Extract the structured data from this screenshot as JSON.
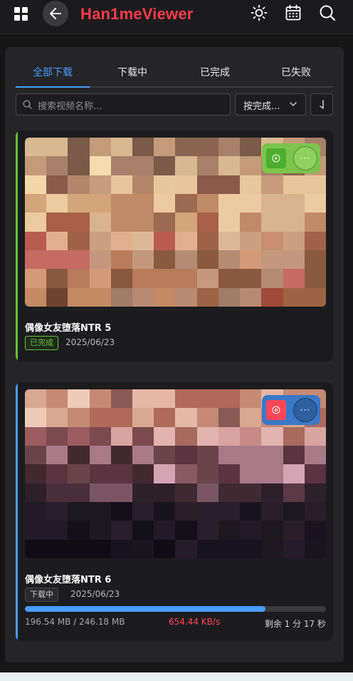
{
  "header": {
    "title": "Han1meViewer",
    "icons": [
      "grid-icon",
      "back-arrow-icon",
      "theme-sun-icon",
      "calendar-icon",
      "search-icon"
    ]
  },
  "tabs": [
    {
      "label": "全部下载",
      "active": true
    },
    {
      "label": "下载中",
      "active": false
    },
    {
      "label": "已完成",
      "active": false
    },
    {
      "label": "已失败",
      "active": false
    }
  ],
  "filters": {
    "search_placeholder": "搜索视频名称...",
    "sort_value": "按完成..."
  },
  "downloads": [
    {
      "title": "偶像女友堕落NTR 5",
      "status": "已完成",
      "date": "2025/06/23",
      "accent_color": "#67c23a"
    },
    {
      "title": "偶像女友堕落NTR 6",
      "status": "下载中",
      "date": "2025/06/23",
      "accent_color": "#4a9dff",
      "progress": 0.8,
      "size": "196.54 MB / 246.18 MB",
      "speed": "654.44 KB/s",
      "remaining": "剩余 1 分 17 秒"
    }
  ],
  "colors": {
    "brand": "#ff3b4c",
    "accent": "#4a9dff",
    "success": "#67c23a",
    "speed": "#ff4757"
  }
}
